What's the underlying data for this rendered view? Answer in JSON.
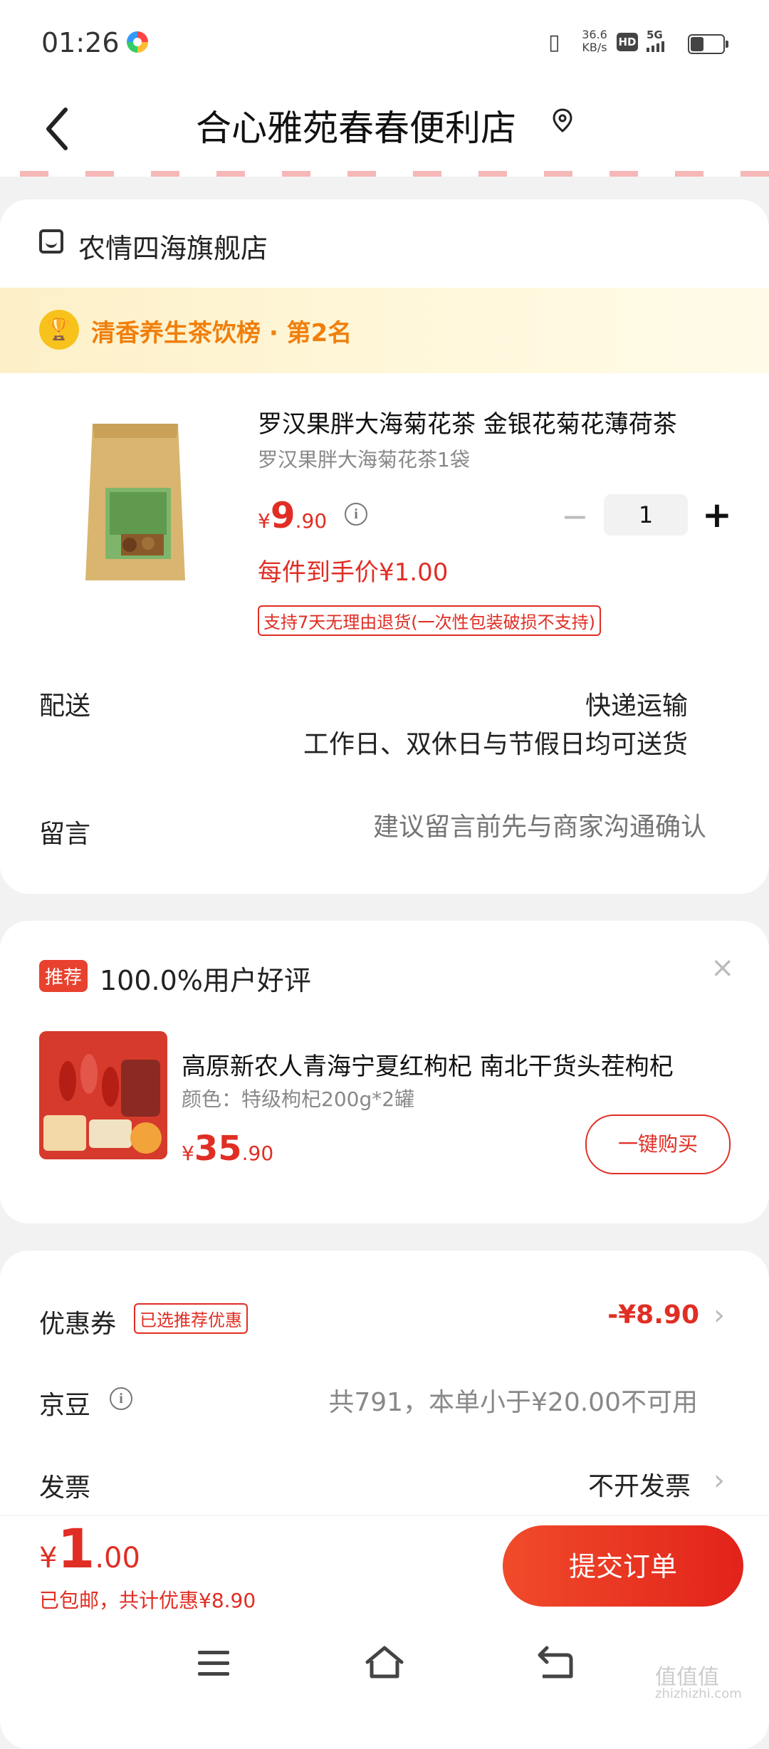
{
  "status_bar": {
    "time": "01:26",
    "net_speed_value": "36.6",
    "net_speed_unit": "KB/s",
    "hd": "HD",
    "signal": "5G"
  },
  "header": {
    "back_icon": "chevron-left-icon",
    "title": "合心雅苑春春便利店",
    "location_icon": "location-pin-icon"
  },
  "store": {
    "name": "农情四海旗舰店",
    "rank_text": "清香养生茶饮榜 · 第2名"
  },
  "product": {
    "title": "罗汉果胖大海菊花茶 金银花菊花薄荷茶",
    "spec": "罗汉果胖大海菊花茶1袋",
    "price_symbol": "¥",
    "price_int": "9",
    "price_dec": ".90",
    "quantity": "1",
    "unit_price_text": "每件到手价¥1.00",
    "return_policy": "支持7天无理由退货(一次性包装破损不支持)"
  },
  "delivery": {
    "label": "配送",
    "method": "快递运输",
    "schedule": "工作日、双休日与节假日均可送货"
  },
  "message": {
    "label": "留言",
    "placeholder": "建议留言前先与商家沟通确认"
  },
  "recommend": {
    "badge": "推荐",
    "rating_text": "100.0%用户好评",
    "close": "×",
    "title": "高原新农人青海宁夏红枸杞 南北干货头茬枸杞",
    "spec": "颜色：特级枸杞200g*2罐",
    "price_symbol": "¥",
    "price_int": "35",
    "price_dec": ".90",
    "buy_label": "一键购买"
  },
  "coupon": {
    "label": "优惠券",
    "tag": "已选推荐优惠",
    "value": "-¥8.90"
  },
  "jd_beans": {
    "label": "京豆",
    "value": "共791，本单小于¥20.00不可用"
  },
  "invoice": {
    "label": "发票",
    "value": "不开发票"
  },
  "footer": {
    "total_symbol": "¥",
    "total_int": "1",
    "total_dec": ".00",
    "subtext": "已包邮，共计优惠¥8.90",
    "submit_label": "提交订单"
  },
  "watermark": {
    "text": "值值值",
    "site": "zhizhizhi.com"
  },
  "colors": {
    "accent": "#e02e24",
    "rank": "#f07f0c",
    "trophy": "#f7c21b"
  }
}
